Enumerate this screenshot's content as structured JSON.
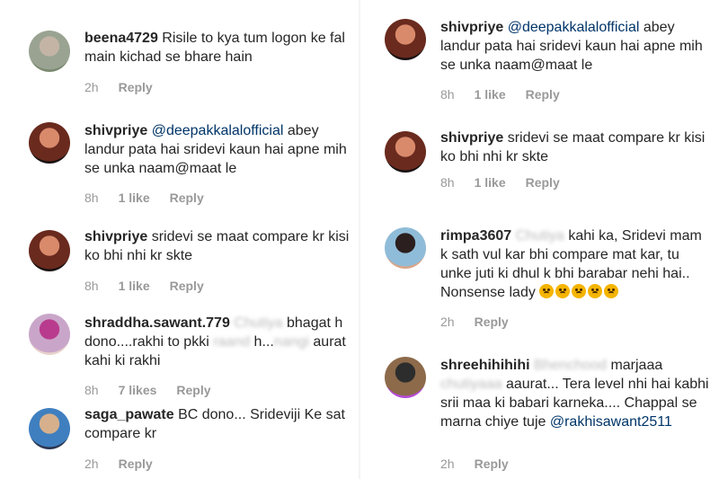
{
  "left": [
    {
      "username": "beena4729",
      "parts": [
        {
          "t": "Risile to kya tum logon ke fal main kichad se bhare hain",
          "k": "plain"
        }
      ],
      "time": "2h",
      "likes": "",
      "reply": "Reply",
      "avatar_colors": [
        "#9aa392",
        "#c3b4a6",
        "#7b8a70"
      ]
    },
    {
      "username": "shivpriye",
      "parts": [
        {
          "t": "@deepakkalalofficial",
          "k": "mention"
        },
        {
          "t": " abey landur pata hai sridevi kaun hai apne mih se unka naam@maat le",
          "k": "plain"
        }
      ],
      "time": "8h",
      "likes": "1 like",
      "reply": "Reply",
      "avatar_colors": [
        "#6a2a1e",
        "#d98a6b",
        "#1a1212"
      ]
    },
    {
      "username": "shivpriye",
      "parts": [
        {
          "t": "sridevi se maat compare kr kisi ko bhi nhi kr skte",
          "k": "plain"
        }
      ],
      "time": "8h",
      "likes": "1 like",
      "reply": "Reply",
      "avatar_colors": [
        "#6a2a1e",
        "#d98a6b",
        "#1a1212"
      ]
    },
    {
      "username": "shraddha.sawant.779",
      "parts": [
        {
          "t": "Chutiya",
          "k": "blur"
        },
        {
          "t": " bhagat h dono....rakhi to pkki ",
          "k": "plain"
        },
        {
          "t": "raand",
          "k": "blur"
        },
        {
          "t": " h...",
          "k": "plain"
        },
        {
          "t": "nangi",
          "k": "blur"
        },
        {
          "t": " aurat kahi ki rakhi",
          "k": "plain"
        }
      ],
      "time": "8h",
      "likes": "7 likes",
      "reply": "Reply",
      "avatar_colors": [
        "#c9a6c9",
        "#b93b8e",
        "#e8d2cc"
      ]
    },
    {
      "username": "saga_pawate",
      "parts": [
        {
          "t": "BC dono... Srideviji Ke sat compare kr",
          "k": "plain"
        }
      ],
      "time": "2h",
      "likes": "",
      "reply": "Reply",
      "avatar_colors": [
        "#3f7fbf",
        "#d6b08c",
        "#2a3550"
      ]
    }
  ],
  "right": [
    {
      "username": "shivpriye",
      "parts": [
        {
          "t": "@deepakkalalofficial",
          "k": "mention"
        },
        {
          "t": " abey landur pata hai sridevi kaun hai apne mih se unka naam@maat le",
          "k": "plain"
        }
      ],
      "time": "8h",
      "likes": "1 like",
      "reply": "Reply",
      "avatar_colors": [
        "#6a2a1e",
        "#d98a6b",
        "#1a1212"
      ]
    },
    {
      "username": "shivpriye",
      "parts": [
        {
          "t": "sridevi se maat compare kr kisi ko bhi nhi kr skte",
          "k": "plain"
        }
      ],
      "time": "8h",
      "likes": "1 like",
      "reply": "Reply",
      "avatar_colors": [
        "#6a2a1e",
        "#d98a6b",
        "#1a1212"
      ]
    },
    {
      "username": "rimpa3607",
      "parts": [
        {
          "t": "Chutiya",
          "k": "blur"
        },
        {
          "t": " kahi ka, Sridevi mam k sath vul kar bhi compare mat kar, tu unke juti ki dhul k bhi barabar nehi hai.. Nonsense lady ",
          "k": "plain"
        },
        {
          "t": "😠😠😠😠😠",
          "k": "emoji"
        }
      ],
      "time": "2h",
      "likes": "",
      "reply": "Reply",
      "avatar_colors": [
        "#8fbcd8",
        "#2b1f1f",
        "#d9a58a"
      ]
    },
    {
      "username": "shreehihihihi",
      "parts": [
        {
          "t": "Bhenchood",
          "k": "blur"
        },
        {
          "t": " marjaaa ",
          "k": "plain"
        },
        {
          "t": "chutiyaaa",
          "k": "blur"
        },
        {
          "t": " aaurat... Tera level nhi hai kabhi srii maa ki babari karneka.... Chappal se marna chiye tuje ",
          "k": "plain"
        },
        {
          "t": "@rakhisawant2511",
          "k": "mention"
        }
      ],
      "time": "2h",
      "likes": "",
      "reply": "Reply",
      "avatar_colors": [
        "#8c6a4a",
        "#2d2d2d",
        "#b64bd6"
      ]
    }
  ]
}
